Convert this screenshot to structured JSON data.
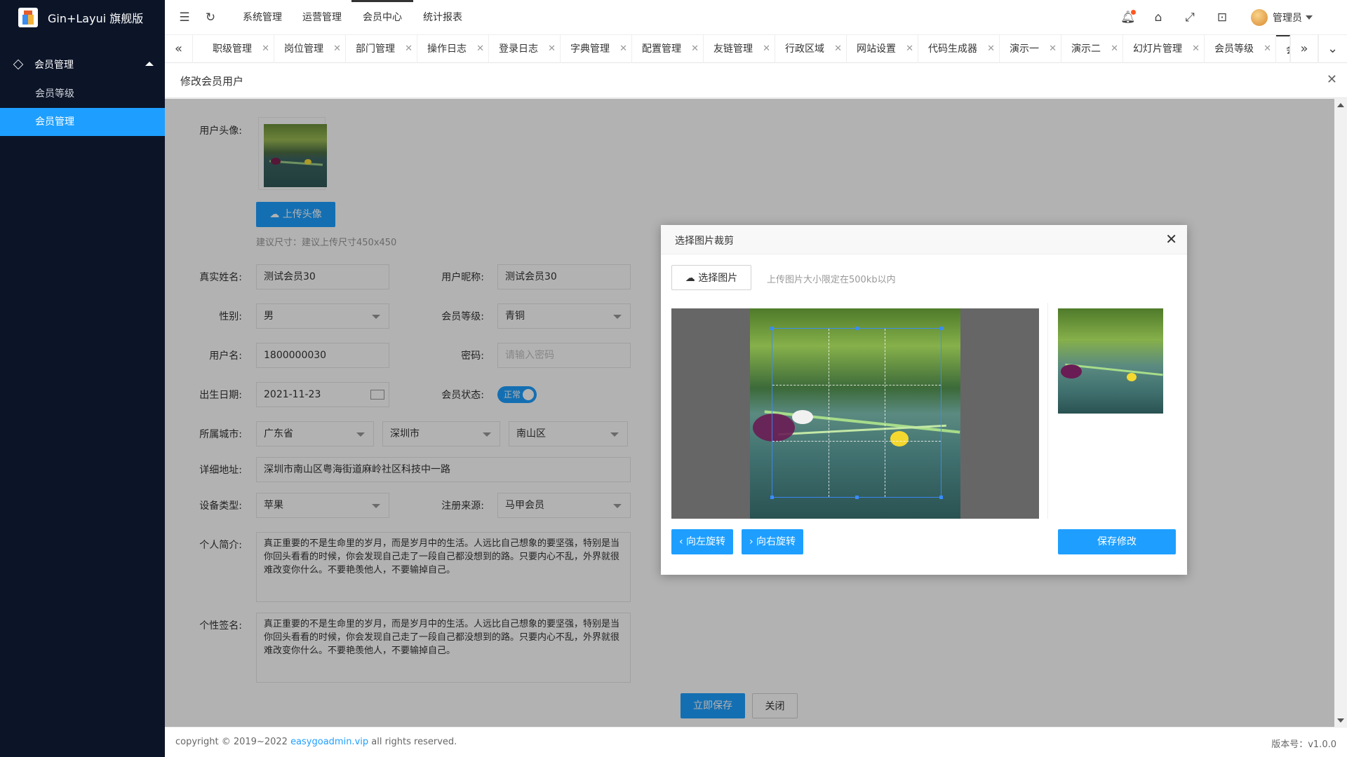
{
  "app": {
    "title": "Gin+Layui 旗舰版"
  },
  "sidebar": {
    "group": "会员管理",
    "items": [
      {
        "label": "会员等级",
        "active": false
      },
      {
        "label": "会员管理",
        "active": true
      }
    ]
  },
  "topnav": {
    "items": [
      "系统管理",
      "运营管理",
      "会员中心",
      "统计报表"
    ],
    "active": "会员中心",
    "user": "管理员"
  },
  "tabs": [
    "职级管理",
    "岗位管理",
    "部门管理",
    "操作日志",
    "登录日志",
    "字典管理",
    "配置管理",
    "友链管理",
    "行政区域",
    "网站设置",
    "代码生成器",
    "演示一",
    "演示二",
    "幻灯片管理",
    "会员等级",
    "会"
  ],
  "page": {
    "title": "修改会员用户"
  },
  "form": {
    "avatar_label": "用户头像:",
    "upload_button": "上传头像",
    "size_hint": "建议尺寸：建议上传尺寸450x450",
    "realname_label": "真实姓名:",
    "realname": "测试会员30",
    "nickname_label": "用户昵称:",
    "nickname": "测试会员30",
    "gender_label": "性别:",
    "gender": "男",
    "level_label": "会员等级:",
    "level": "青铜",
    "username_label": "用户名:",
    "username": "1800000030",
    "password_label": "密码:",
    "password_placeholder": "请输入密码",
    "birthday_label": "出生日期:",
    "birthday": "2021-11-23",
    "status_label": "会员状态:",
    "status": "正常",
    "city_label": "所属城市:",
    "province": "广东省",
    "city": "深圳市",
    "district": "南山区",
    "address_label": "详细地址:",
    "address": "深圳市南山区粤海街道麻岭社区科技中一路",
    "device_label": "设备类型:",
    "device": "苹果",
    "source_label": "注册来源:",
    "source": "马甲会员",
    "intro_label": "个人简介:",
    "intro": "真正重要的不是生命里的岁月，而是岁月中的生活。人远比自己想象的要坚强，特别是当你回头看看的时候，你会发现自己走了一段自己都没想到的路。只要内心不乱，外界就很难改变你什么。不要艳羡他人，不要输掉自己。",
    "sign_label": "个性签名:",
    "sign": "真正重要的不是生命里的岁月，而是岁月中的生活。人远比自己想象的要坚强，特别是当你回头看看的时候，你会发现自己走了一段自己都没想到的路。只要内心不乱，外界就很难改变你什么。不要艳羡他人，不要输掉自己。",
    "save_button": "立即保存",
    "close_button": "关闭"
  },
  "modal": {
    "title": "选择图片裁剪",
    "choose_button": "选择图片",
    "choose_hint": "上传图片大小限定在500kb以内",
    "rotate_left": "向左旋转",
    "rotate_right": "向右旋转",
    "save": "保存修改"
  },
  "footer": {
    "copyright": "copyright © 2019~2022 ",
    "link": "easygoadmin.vip",
    "rights": " all rights reserved.",
    "version": "版本号：v1.0.0"
  },
  "colors": {
    "accent": "#1e9fff",
    "sidebar": "#0c1528"
  }
}
